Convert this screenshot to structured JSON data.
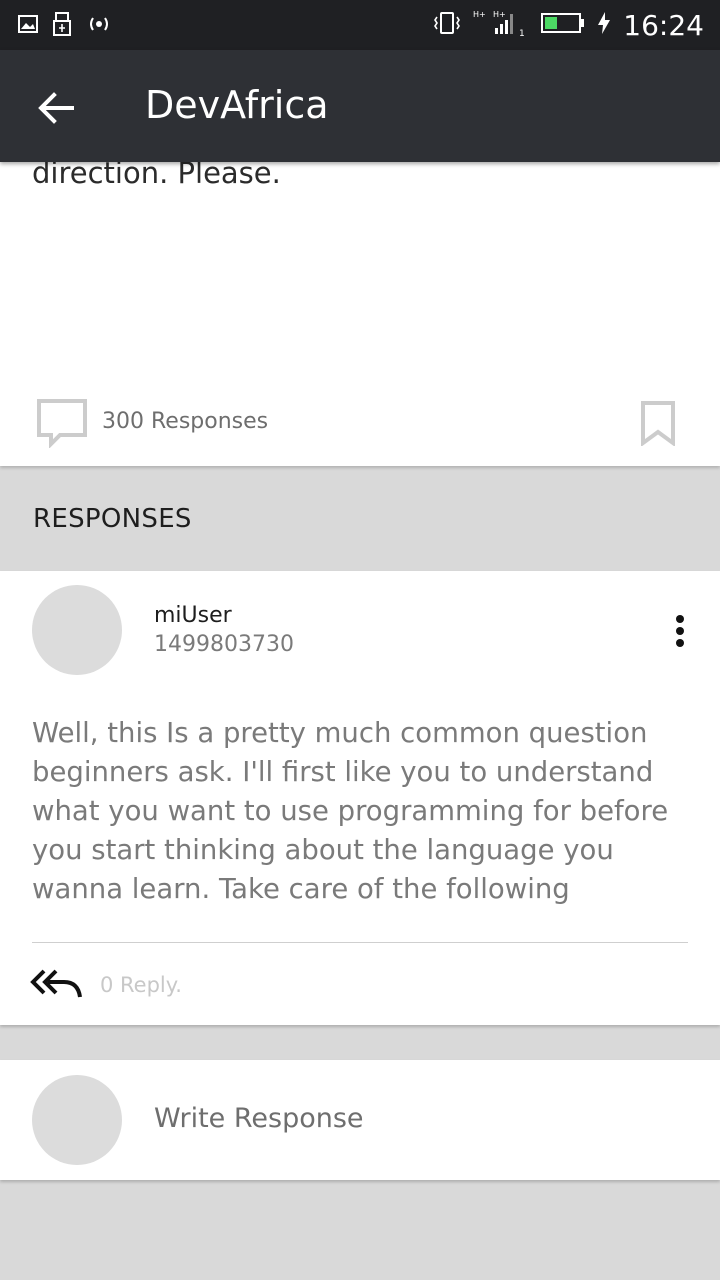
{
  "status_bar": {
    "time": "16:24",
    "icons": [
      "image-icon",
      "usb-icon",
      "hotspot-icon",
      "vibrate-icon",
      "signal-icon",
      "battery-icon",
      "charging-icon"
    ]
  },
  "app_bar": {
    "title": "DevAfrica",
    "back_icon": "arrow-left-icon",
    "background": "#2e3035"
  },
  "post": {
    "text_tail": "direction. Please.",
    "responses_count": "300 Responses",
    "comment_icon": "chat-bubble-icon",
    "bookmark_icon": "bookmark-icon"
  },
  "responses_section": {
    "label": "RESPONSES"
  },
  "response": {
    "username": "miUser",
    "timestamp": "1499803730",
    "more_icon": "more-vert-icon",
    "body": "Well, this Is a pretty much common question beginners ask. I'll first like you to understand what you want to use programming for before you start thinking about the language you wanna learn. Take care of the following",
    "reply_icon": "reply-all-icon",
    "reply_count": "0 Reply."
  },
  "write_response": {
    "placeholder": "Write Response"
  }
}
